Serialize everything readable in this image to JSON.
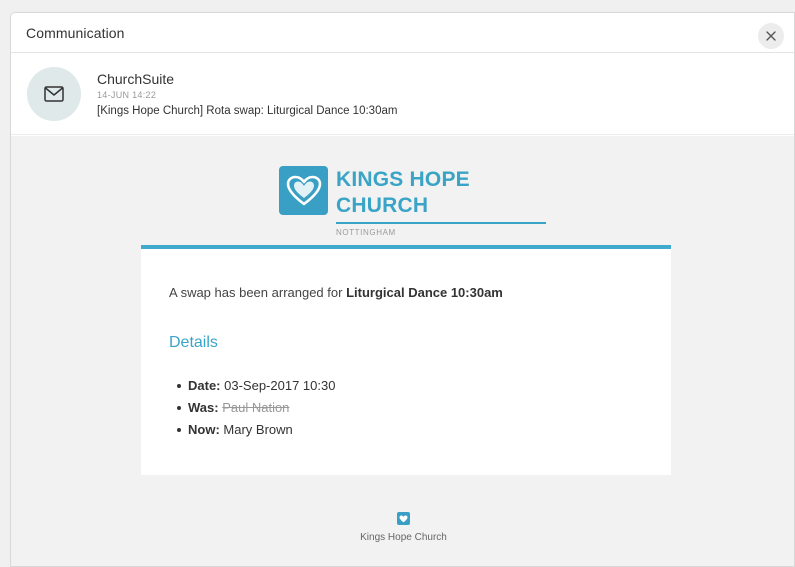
{
  "modal": {
    "title": "Communication",
    "close_icon": "close-icon"
  },
  "message": {
    "avatar_icon": "envelope-icon",
    "sender": "ChurchSuite",
    "timestamp": "14-JUN 14:22",
    "subject": "[Kings Hope Church] Rota swap: Liturgical Dance 10:30am"
  },
  "email": {
    "logo_icon": "heart-icon",
    "church_name": "KINGS HOPE CHURCH",
    "church_location": "NOTTINGHAM",
    "intro_prefix": "A swap has been arranged for",
    "intro_bold": "Liturgical Dance 10:30am",
    "details_heading": "Details",
    "details": [
      {
        "label": "Date:",
        "value": "03-Sep-2017 10:30"
      },
      {
        "label": "Was:",
        "value": "Paul Nation"
      },
      {
        "label": "Now:",
        "value": "Mary Brown"
      }
    ],
    "footer_name": "Kings Hope Church"
  },
  "colors": {
    "accent": "#3aa4c6",
    "brand_tile": "#3a9fc4",
    "avatar_bg": "#dfe9ea",
    "body_bg": "#f2f2f2"
  }
}
